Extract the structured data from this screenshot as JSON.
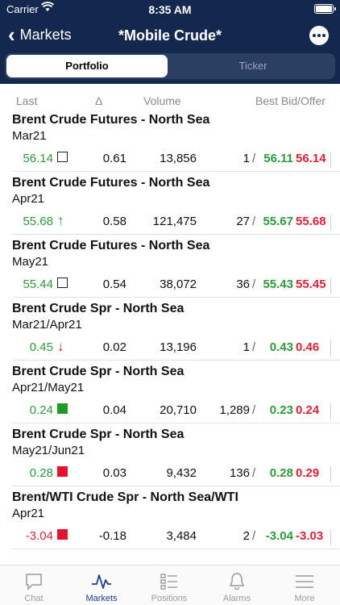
{
  "status_bar": {
    "carrier": "Carrier",
    "time": "8:35 AM"
  },
  "nav": {
    "back_label": "Markets",
    "title": "*Mobile Crude*"
  },
  "segments": {
    "active": "Portfolio",
    "inactive": "Ticker"
  },
  "columns": {
    "last": "Last",
    "delta": "Δ",
    "volume": "Volume",
    "best": "Best Bid/Offer"
  },
  "rows": [
    {
      "name": "Brent Crude Futures - North Sea",
      "expiry": "Mar21",
      "last": "56.14",
      "indicator": "empty",
      "delta": "0.61",
      "volume": "13,856",
      "bid_qty": "1",
      "bid": "56.11",
      "offer": "56.14"
    },
    {
      "name": "Brent Crude Futures - North Sea",
      "expiry": "Apr21",
      "last": "55.68",
      "indicator": "up",
      "delta": "0.58",
      "volume": "121,475",
      "bid_qty": "27",
      "bid": "55.67",
      "offer": "55.68"
    },
    {
      "name": "Brent Crude Futures - North Sea",
      "expiry": "May21",
      "last": "55.44",
      "indicator": "empty",
      "delta": "0.54",
      "volume": "38,072",
      "bid_qty": "36",
      "bid": "55.43",
      "offer": "55.45"
    },
    {
      "name": "Brent Crude Spr - North Sea",
      "expiry": "Mar21/Apr21",
      "last": "0.45",
      "indicator": "down",
      "delta": "0.02",
      "volume": "13,196",
      "bid_qty": "1",
      "bid": "0.43",
      "offer": "0.46"
    },
    {
      "name": "Brent Crude Spr - North Sea",
      "expiry": "Apr21/May21",
      "last": "0.24",
      "indicator": "green",
      "delta": "0.04",
      "volume": "20,710",
      "bid_qty": "1,289",
      "bid": "0.23",
      "offer": "0.24"
    },
    {
      "name": "Brent Crude Spr - North Sea",
      "expiry": "May21/Jun21",
      "last": "0.28",
      "indicator": "red",
      "delta": "0.03",
      "volume": "9,432",
      "bid_qty": "136",
      "bid": "0.28",
      "offer": "0.29"
    },
    {
      "name": "Brent/WTI Crude Spr - North Sea/WTI",
      "expiry": "Apr21",
      "last": "-3.04",
      "indicator": "red",
      "delta": "-0.18",
      "volume": "3,484",
      "bid_qty": "2",
      "bid": "-3.04",
      "offer": "-3.03"
    }
  ],
  "separator": "/",
  "tabs": [
    {
      "label": "Chat",
      "icon": "chat-icon"
    },
    {
      "label": "Markets",
      "icon": "markets-icon",
      "active": true
    },
    {
      "label": "Positions",
      "icon": "positions-icon"
    },
    {
      "label": "Alarms",
      "icon": "bell-icon"
    },
    {
      "label": "More",
      "icon": "menu-icon"
    }
  ],
  "colors": {
    "header": "#14284d",
    "up": "#2e9a3a",
    "down": "#d8243b",
    "active_tab": "#1f3f8a"
  }
}
